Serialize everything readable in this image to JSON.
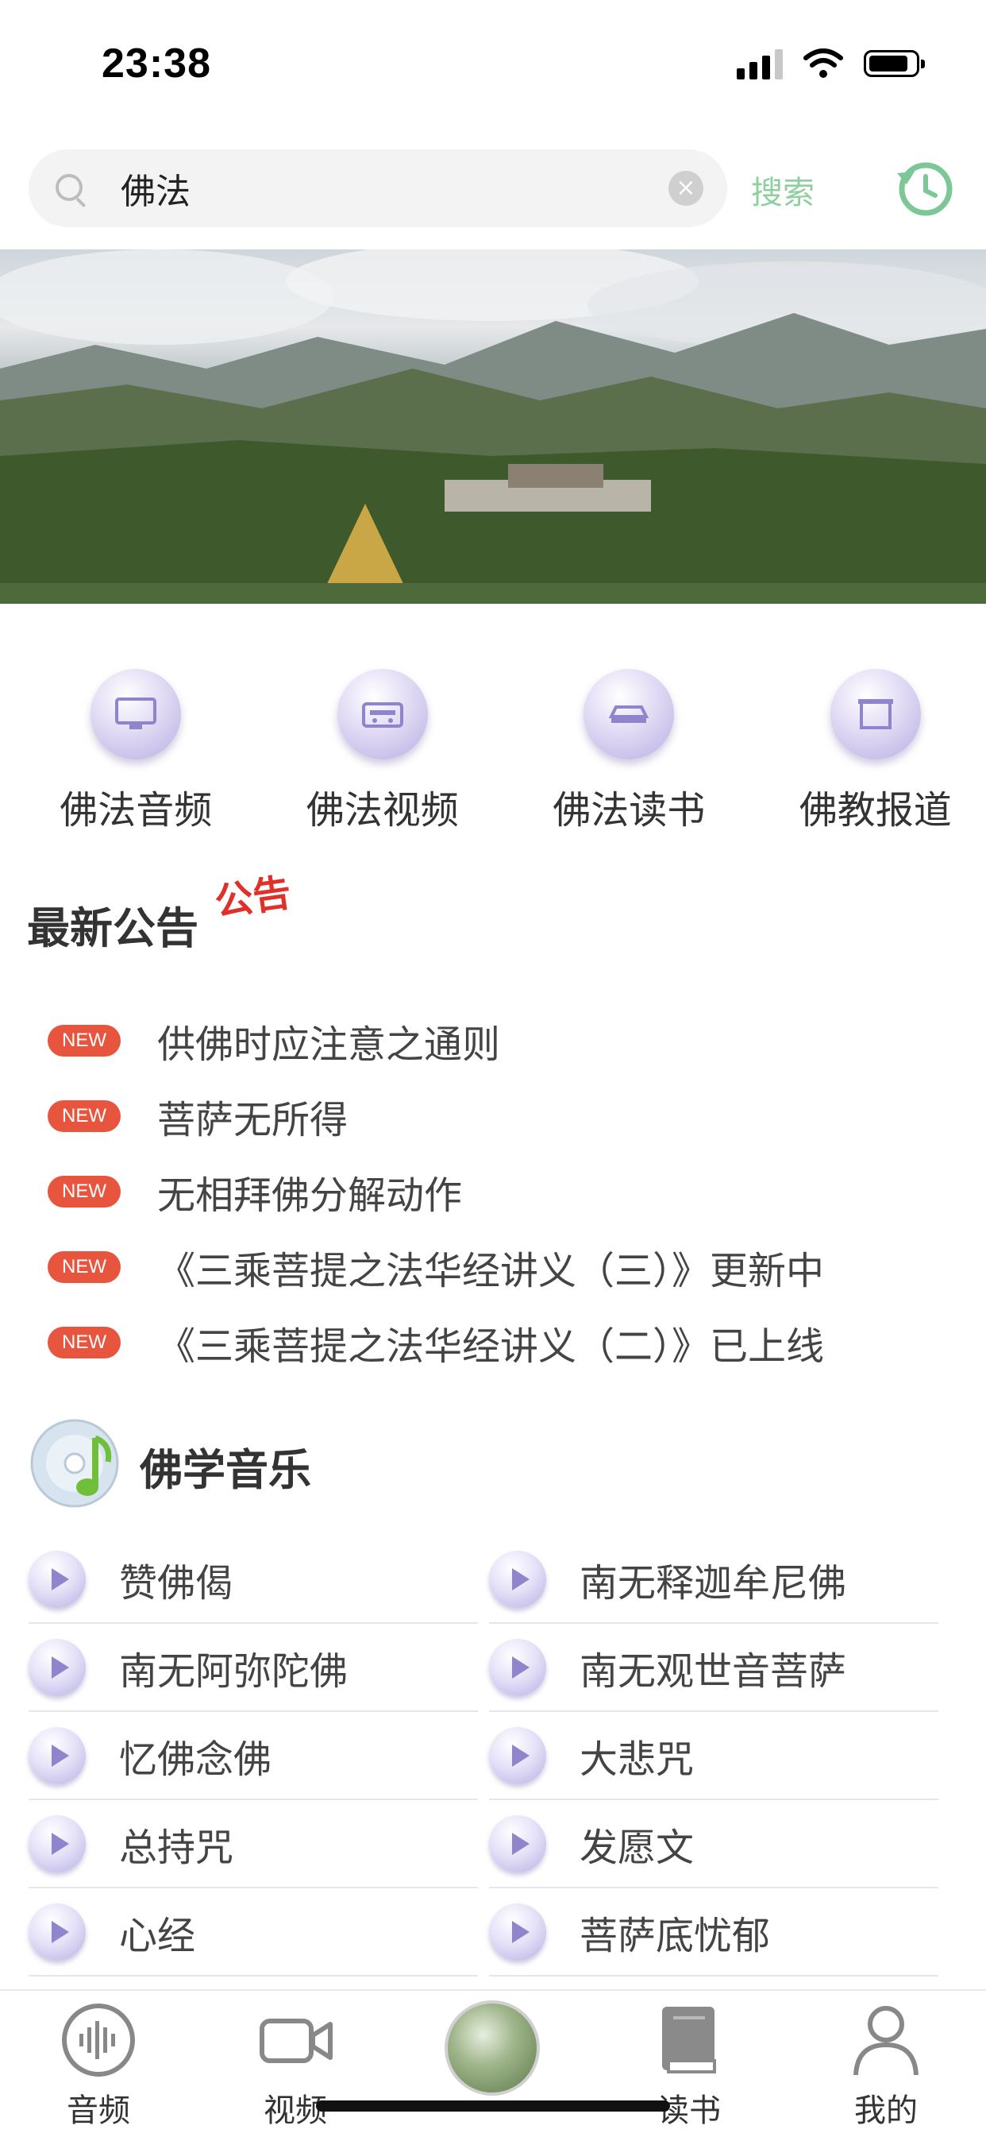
{
  "status_bar": {
    "time": "23:38"
  },
  "search": {
    "value": "佛法",
    "button_label": "搜索"
  },
  "categories": [
    {
      "label": "佛法音频",
      "icon": "monitor-icon"
    },
    {
      "label": "佛法视频",
      "icon": "radio-icon"
    },
    {
      "label": "佛法读书",
      "icon": "device-icon"
    },
    {
      "label": "佛教报道",
      "icon": "frame-icon"
    }
  ],
  "announcements": {
    "title": "最新公告",
    "badge": "公告",
    "new_label": "NEW",
    "items": [
      "供佛时应注意之通则",
      "菩萨无所得",
      "无相拜佛分解动作",
      "《三乘菩提之法华经讲义（三）》更新中",
      "《三乘菩提之法华经讲义（二）》已上线"
    ]
  },
  "music": {
    "title": "佛学音乐",
    "items": [
      "赞佛偈",
      "南无释迦牟尼佛",
      "南无阿弥陀佛",
      "南无观世音菩萨",
      "忆佛念佛",
      "大悲咒",
      "总持咒",
      "发愿文",
      "心经",
      "菩萨底忧郁"
    ]
  },
  "tabs": [
    {
      "label": "音频",
      "icon": "audio-wave-icon"
    },
    {
      "label": "视频",
      "icon": "video-camera-icon"
    },
    {
      "label": "",
      "icon": "center-play-icon"
    },
    {
      "label": "读书",
      "icon": "book-icon"
    },
    {
      "label": "我的",
      "icon": "person-icon"
    }
  ],
  "colors": {
    "accent_green": "#7cc796",
    "new_badge": "#e8553e",
    "icon_purple": "#b8aee2"
  }
}
